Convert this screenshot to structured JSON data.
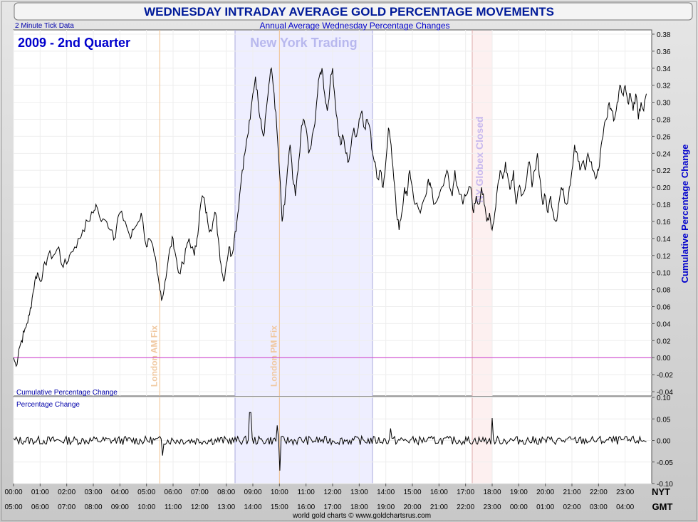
{
  "chart_data": [
    {
      "type": "line",
      "title": "WEDNESDAY INTRADAY AVERAGE GOLD PERCENTAGE MOVEMENTS",
      "subtitle": "Annual Average Wednesday Percentage Changes",
      "period_label": "2009 - 2nd Quarter",
      "tick_note": "2 Minute Tick Data",
      "panel_label": "Cumulative Percentage Change",
      "ylabel": "Cumulative Percentage Change",
      "ylim": [
        -0.045,
        0.385
      ],
      "yticks": [
        "0.38",
        "0.36",
        "0.34",
        "0.32",
        "0.30",
        "0.28",
        "0.26",
        "0.24",
        "0.22",
        "0.20",
        "0.18",
        "0.16",
        "0.14",
        "0.12",
        "0.10",
        "0.08",
        "0.06",
        "0.04",
        "0.02",
        "0.00",
        "-0.02",
        "-0.04"
      ],
      "xlim": [
        0,
        24
      ],
      "x_axis_nyt": [
        "00:00",
        "01:00",
        "02:00",
        "03:00",
        "04:00",
        "05:00",
        "06:00",
        "07:00",
        "08:00",
        "09:00",
        "10:00",
        "11:00",
        "12:00",
        "13:00",
        "14:00",
        "15:00",
        "16:00",
        "17:00",
        "18:00",
        "19:00",
        "20:00",
        "21:00",
        "22:00",
        "23:00"
      ],
      "x_axis_gmt": [
        "05:00",
        "06:00",
        "07:00",
        "08:00",
        "09:00",
        "10:00",
        "11:00",
        "12:00",
        "13:00",
        "14:00",
        "15:00",
        "16:00",
        "17:00",
        "18:00",
        "19:00",
        "20:00",
        "21:00",
        "22:00",
        "23:00",
        "00:00",
        "01:00",
        "02:00",
        "03:00",
        "04:00"
      ],
      "axis_nyt_label": "NYT",
      "axis_gmt_label": "GMT",
      "zero_line_color": "#cc33cc",
      "regions": [
        {
          "label": "New York Trading",
          "start": 8.33,
          "end": 13.5,
          "color": "#eeeeff"
        },
        {
          "label": "NY Globex Closed",
          "start": 17.25,
          "end": 18.0,
          "color": "#fdf0f0"
        }
      ],
      "markers": [
        {
          "label": "London AM Fix",
          "x": 5.5
        },
        {
          "label": "London PM Fix",
          "x": 10.0
        }
      ],
      "series": [
        {
          "color": "#000000",
          "points": [
            [
              0.0,
              0.0
            ],
            [
              0.1,
              -0.01
            ],
            [
              0.2,
              0.01
            ],
            [
              0.3,
              0.02
            ],
            [
              0.4,
              0.03
            ],
            [
              0.5,
              0.04
            ],
            [
              0.6,
              0.05
            ],
            [
              0.7,
              0.07
            ],
            [
              0.8,
              0.09
            ],
            [
              0.9,
              0.1
            ],
            [
              1.0,
              0.09
            ],
            [
              1.1,
              0.1
            ],
            [
              1.2,
              0.11
            ],
            [
              1.3,
              0.12
            ],
            [
              1.5,
              0.12
            ],
            [
              1.7,
              0.13
            ],
            [
              1.8,
              0.11
            ],
            [
              2.0,
              0.11
            ],
            [
              2.1,
              0.12
            ],
            [
              2.3,
              0.13
            ],
            [
              2.5,
              0.14
            ],
            [
              2.6,
              0.15
            ],
            [
              2.8,
              0.16
            ],
            [
              3.0,
              0.17
            ],
            [
              3.1,
              0.18
            ],
            [
              3.3,
              0.16
            ],
            [
              3.5,
              0.16
            ],
            [
              3.7,
              0.15
            ],
            [
              3.8,
              0.14
            ],
            [
              3.9,
              0.16
            ],
            [
              4.0,
              0.17
            ],
            [
              4.2,
              0.16
            ],
            [
              4.4,
              0.14
            ],
            [
              4.5,
              0.15
            ],
            [
              4.7,
              0.16
            ],
            [
              4.8,
              0.17
            ],
            [
              5.0,
              0.13
            ],
            [
              5.1,
              0.14
            ],
            [
              5.3,
              0.12
            ],
            [
              5.4,
              0.1
            ],
            [
              5.5,
              0.08
            ],
            [
              5.6,
              0.07
            ],
            [
              5.7,
              0.09
            ],
            [
              5.8,
              0.11
            ],
            [
              5.9,
              0.13
            ],
            [
              6.0,
              0.14
            ],
            [
              6.1,
              0.12
            ],
            [
              6.2,
              0.1
            ],
            [
              6.4,
              0.11
            ],
            [
              6.5,
              0.13
            ],
            [
              6.6,
              0.14
            ],
            [
              6.8,
              0.12
            ],
            [
              6.9,
              0.14
            ],
            [
              7.0,
              0.17
            ],
            [
              7.1,
              0.19
            ],
            [
              7.2,
              0.18
            ],
            [
              7.3,
              0.16
            ],
            [
              7.4,
              0.15
            ],
            [
              7.5,
              0.16
            ],
            [
              7.6,
              0.17
            ],
            [
              7.7,
              0.14
            ],
            [
              7.8,
              0.11
            ],
            [
              7.9,
              0.09
            ],
            [
              8.0,
              0.11
            ],
            [
              8.1,
              0.13
            ],
            [
              8.2,
              0.12
            ],
            [
              8.3,
              0.14
            ],
            [
              8.4,
              0.16
            ],
            [
              8.5,
              0.19
            ],
            [
              8.6,
              0.22
            ],
            [
              8.7,
              0.24
            ],
            [
              8.8,
              0.26
            ],
            [
              8.9,
              0.28
            ],
            [
              9.0,
              0.31
            ],
            [
              9.1,
              0.33
            ],
            [
              9.2,
              0.3
            ],
            [
              9.3,
              0.28
            ],
            [
              9.4,
              0.26
            ],
            [
              9.5,
              0.29
            ],
            [
              9.6,
              0.32
            ],
            [
              9.7,
              0.34
            ],
            [
              9.8,
              0.31
            ],
            [
              9.9,
              0.27
            ],
            [
              10.0,
              0.22
            ],
            [
              10.1,
              0.16
            ],
            [
              10.2,
              0.18
            ],
            [
              10.3,
              0.22
            ],
            [
              10.4,
              0.25
            ],
            [
              10.5,
              0.21
            ],
            [
              10.6,
              0.19
            ],
            [
              10.7,
              0.22
            ],
            [
              10.8,
              0.26
            ],
            [
              10.9,
              0.28
            ],
            [
              11.0,
              0.27
            ],
            [
              11.1,
              0.24
            ],
            [
              11.2,
              0.25
            ],
            [
              11.3,
              0.27
            ],
            [
              11.4,
              0.3
            ],
            [
              11.5,
              0.33
            ],
            [
              11.6,
              0.34
            ],
            [
              11.7,
              0.31
            ],
            [
              11.8,
              0.29
            ],
            [
              11.9,
              0.32
            ],
            [
              12.0,
              0.34
            ],
            [
              12.1,
              0.3
            ],
            [
              12.2,
              0.27
            ],
            [
              12.3,
              0.25
            ],
            [
              12.4,
              0.26
            ],
            [
              12.5,
              0.24
            ],
            [
              12.6,
              0.23
            ],
            [
              12.7,
              0.25
            ],
            [
              12.8,
              0.27
            ],
            [
              12.9,
              0.26
            ],
            [
              13.0,
              0.28
            ],
            [
              13.1,
              0.29
            ],
            [
              13.2,
              0.27
            ],
            [
              13.3,
              0.28
            ],
            [
              13.4,
              0.27
            ],
            [
              13.5,
              0.24
            ],
            [
              13.6,
              0.23
            ],
            [
              13.7,
              0.21
            ],
            [
              13.8,
              0.22
            ],
            [
              13.9,
              0.2
            ],
            [
              14.0,
              0.23
            ],
            [
              14.1,
              0.27
            ],
            [
              14.2,
              0.25
            ],
            [
              14.3,
              0.21
            ],
            [
              14.4,
              0.17
            ],
            [
              14.5,
              0.15
            ],
            [
              14.6,
              0.17
            ],
            [
              14.7,
              0.2
            ],
            [
              14.8,
              0.19
            ],
            [
              14.9,
              0.22
            ],
            [
              15.0,
              0.2
            ],
            [
              15.1,
              0.18
            ],
            [
              15.3,
              0.17
            ],
            [
              15.5,
              0.19
            ],
            [
              15.6,
              0.21
            ],
            [
              15.7,
              0.2
            ],
            [
              15.8,
              0.18
            ],
            [
              16.0,
              0.19
            ],
            [
              16.1,
              0.2
            ],
            [
              16.3,
              0.22
            ],
            [
              16.4,
              0.2
            ],
            [
              16.5,
              0.19
            ],
            [
              16.6,
              0.22
            ],
            [
              16.7,
              0.2
            ],
            [
              16.9,
              0.18
            ],
            [
              17.0,
              0.19
            ],
            [
              17.2,
              0.2
            ],
            [
              17.3,
              0.17
            ],
            [
              17.4,
              0.19
            ],
            [
              17.5,
              0.18
            ],
            [
              17.6,
              0.2
            ],
            [
              17.7,
              0.18
            ],
            [
              17.8,
              0.16
            ],
            [
              17.9,
              0.17
            ],
            [
              18.0,
              0.15
            ],
            [
              18.1,
              0.17
            ],
            [
              18.2,
              0.2
            ],
            [
              18.3,
              0.22
            ],
            [
              18.4,
              0.21
            ],
            [
              18.5,
              0.23
            ],
            [
              18.6,
              0.21
            ],
            [
              18.7,
              0.2
            ],
            [
              18.8,
              0.22
            ],
            [
              18.9,
              0.18
            ],
            [
              19.0,
              0.2
            ],
            [
              19.1,
              0.19
            ],
            [
              19.3,
              0.21
            ],
            [
              19.4,
              0.23
            ],
            [
              19.5,
              0.2
            ],
            [
              19.6,
              0.22
            ],
            [
              19.7,
              0.24
            ],
            [
              19.8,
              0.21
            ],
            [
              19.9,
              0.18
            ],
            [
              20.0,
              0.19
            ],
            [
              20.1,
              0.17
            ],
            [
              20.2,
              0.19
            ],
            [
              20.3,
              0.17
            ],
            [
              20.4,
              0.16
            ],
            [
              20.5,
              0.18
            ],
            [
              20.6,
              0.2
            ],
            [
              20.7,
              0.19
            ],
            [
              20.8,
              0.18
            ],
            [
              20.9,
              0.2
            ],
            [
              21.0,
              0.22
            ],
            [
              21.1,
              0.25
            ],
            [
              21.2,
              0.24
            ],
            [
              21.3,
              0.22
            ],
            [
              21.4,
              0.23
            ],
            [
              21.5,
              0.22
            ],
            [
              21.6,
              0.24
            ],
            [
              21.7,
              0.23
            ],
            [
              21.8,
              0.22
            ],
            [
              21.9,
              0.21
            ],
            [
              22.0,
              0.22
            ],
            [
              22.1,
              0.25
            ],
            [
              22.2,
              0.27
            ],
            [
              22.3,
              0.28
            ],
            [
              22.4,
              0.3
            ],
            [
              22.5,
              0.29
            ],
            [
              22.6,
              0.28
            ],
            [
              22.7,
              0.3
            ],
            [
              22.8,
              0.32
            ],
            [
              22.9,
              0.31
            ],
            [
              23.0,
              0.32
            ],
            [
              23.1,
              0.3
            ],
            [
              23.2,
              0.31
            ],
            [
              23.3,
              0.29
            ],
            [
              23.4,
              0.31
            ],
            [
              23.5,
              0.28
            ],
            [
              23.6,
              0.3
            ],
            [
              23.7,
              0.29
            ],
            [
              23.8,
              0.31
            ]
          ]
        }
      ]
    },
    {
      "type": "line",
      "panel_label": "Percentage Change",
      "ylim": [
        -0.1,
        0.1
      ],
      "yticks": [
        "0.10",
        "0.05",
        "0.00",
        "-0.05",
        "-0.10"
      ],
      "xlim": [
        0,
        24
      ],
      "noise_amplitude": 0.01,
      "spikes": [
        {
          "x": 8.9,
          "value": 0.065
        },
        {
          "x": 10.0,
          "value": -0.07
        },
        {
          "x": 18.0,
          "value": 0.052
        },
        {
          "x": 5.6,
          "value": -0.035
        },
        {
          "x": 14.2,
          "value": 0.028
        },
        {
          "x": 9.9,
          "value": 0.035
        }
      ],
      "series": [
        {
          "color": "#000000"
        }
      ]
    }
  ],
  "footer": {
    "credit": "world gold charts © www.goldchartsrus.com"
  }
}
